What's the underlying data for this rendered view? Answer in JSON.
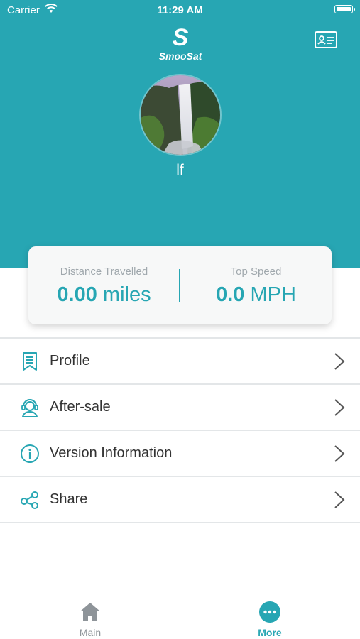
{
  "status_bar": {
    "carrier": "Carrier",
    "time": "11:29 AM"
  },
  "header": {
    "logo_mark": "S",
    "logo_text": "SmooSat",
    "username": "lf",
    "card_icon": "id-card-icon",
    "background_color": "#27a6b3"
  },
  "stats": {
    "distance": {
      "label": "Distance Travelled",
      "value": "0.00",
      "unit": "miles"
    },
    "top_speed": {
      "label": "Top Speed",
      "value": "0.0",
      "unit": "MPH"
    }
  },
  "menu": {
    "items": [
      {
        "label": "Profile",
        "icon": "profile-document-icon"
      },
      {
        "label": "After-sale",
        "icon": "customer-service-icon"
      },
      {
        "label": "Version Information",
        "icon": "info-icon"
      },
      {
        "label": "Share",
        "icon": "share-icon"
      }
    ]
  },
  "tabbar": {
    "main": {
      "label": "Main",
      "icon": "home-icon"
    },
    "more": {
      "label": "More",
      "icon": "more-dots-icon"
    }
  },
  "colors": {
    "accent": "#27a6b3",
    "inactive": "#8e9499"
  }
}
